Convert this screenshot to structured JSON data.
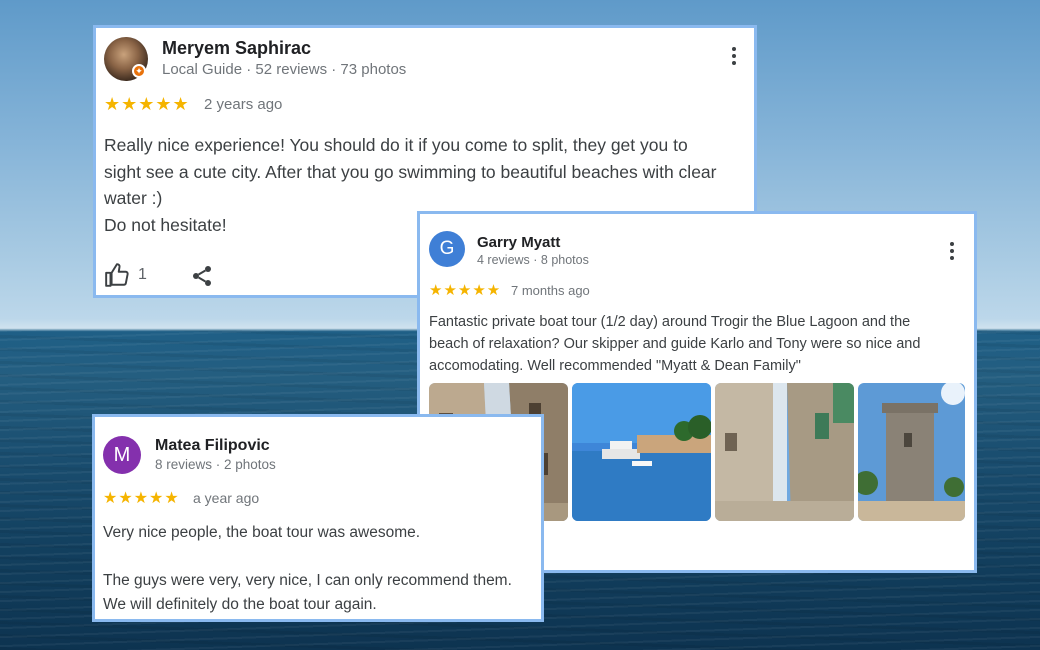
{
  "reviews": [
    {
      "name": "Meryem Saphirac",
      "meta": "Local Guide · 52 reviews · 73 photos",
      "stars": "★★★★★",
      "time": "2 years ago",
      "text": [
        "Really nice experience! You should do it if you come to split, they get you to",
        "sight see a cute city. After that you go swimming to beautiful beaches with clear",
        "water :)",
        "Do not hesitate!"
      ],
      "likes": "1"
    },
    {
      "name": "Garry Myatt",
      "avatar_letter": "G",
      "avatar_color": "#3f7fd6",
      "meta": "4 reviews · 8 photos",
      "stars": "★★★★★",
      "time": "7 months ago",
      "text": [
        "Fantastic private boat tour (1/2 day) around Trogir the Blue Lagoon and the",
        "beach of relaxation? Our skipper and guide Karlo and Tony were so nice and",
        "accomodating. Well recommended \"Myatt & Dean Family\""
      ]
    },
    {
      "name": "Matea Filipovic",
      "avatar_letter": "M",
      "avatar_color": "#8430ad",
      "meta": "8 reviews · 2 photos",
      "stars": "★★★★★",
      "time": "a year ago",
      "text": [
        "Very nice people, the boat tour was awesome.",
        "",
        "The guys were very, very nice, I can only recommend them.",
        "We will definitely do the boat tour again."
      ]
    }
  ]
}
